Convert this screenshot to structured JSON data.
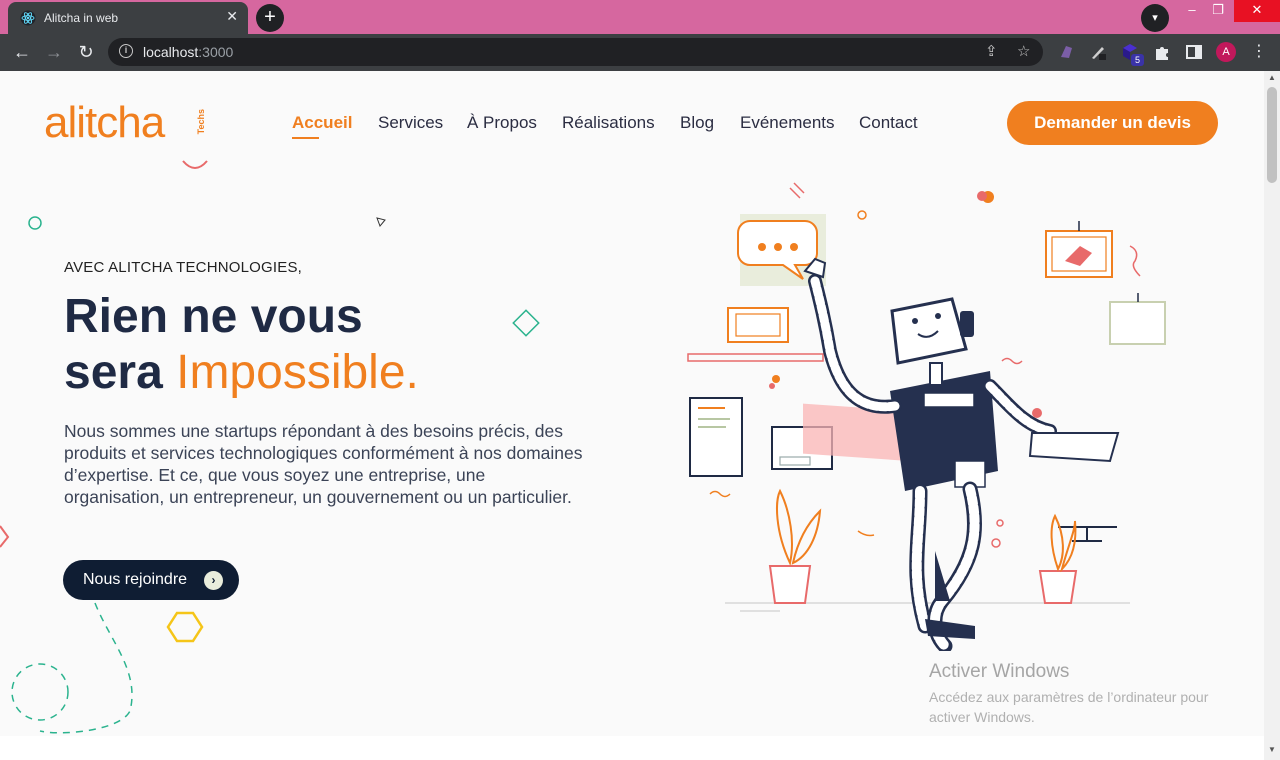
{
  "browser": {
    "tab_title": "Alitcha in web",
    "tab_close": "✕",
    "new_tab": "+",
    "url_host": "localhost",
    "url_port": ":3000",
    "profile_initial": "A",
    "extension_badge": "5"
  },
  "header": {
    "logo_text": "alitcha",
    "logo_sub": "Techs",
    "nav": [
      {
        "label": "Accueil",
        "active": true
      },
      {
        "label": "Services"
      },
      {
        "label": "À Propos"
      },
      {
        "label": "Réalisations"
      },
      {
        "label": "Blog"
      },
      {
        "label": "Evénements"
      },
      {
        "label": "Contact"
      }
    ],
    "cta_label": "Demander un devis"
  },
  "hero": {
    "eyebrow": "AVEC ALITCHA TECHNOLOGIES,",
    "headline_line1": "Rien ne vous",
    "headline_line2_start": "sera ",
    "headline_line2_accent": "Impossible.",
    "description": "Nous sommes une startups répondant à des besoins précis, des produits et services technologiques conformément à nos domaines d’expertise. Et ce, que vous soyez une entreprise, une organisation, un entrepreneur, un gouvernement ou un particulier.",
    "join_label": "Nous rejoindre",
    "join_arrow": "›"
  },
  "os_watermark": {
    "title": "Activer Windows",
    "subtitle": "Accédez aux paramètres de l’ordinateur pour activer Windows."
  },
  "colors": {
    "accent": "#f07f1f",
    "navy": "#1f2a44",
    "tabbar": "#d6679f"
  }
}
